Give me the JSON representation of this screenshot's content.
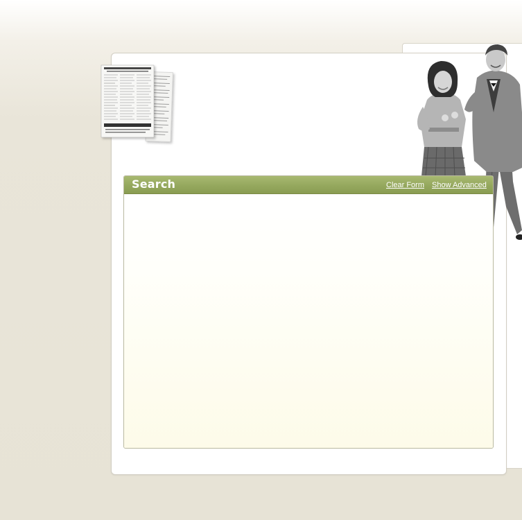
{
  "search_panel": {
    "title": "Search",
    "clear_form_label": "Clear Form",
    "show_advanced_label": "Show Advanced"
  },
  "colors": {
    "header_green": "#95a85e",
    "page_background": "#e7e3d6",
    "panel_body": "#fdfbe9"
  },
  "images": {
    "newspaper": "newspaper-clipping-icon",
    "people": "vintage-couple-photo"
  }
}
